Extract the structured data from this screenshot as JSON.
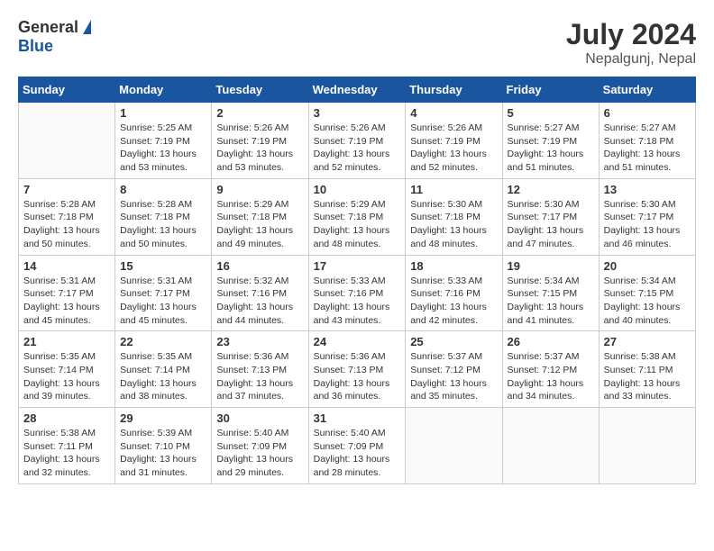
{
  "header": {
    "logo_general": "General",
    "logo_blue": "Blue",
    "month_year": "July 2024",
    "location": "Nepalgunj, Nepal"
  },
  "weekdays": [
    "Sunday",
    "Monday",
    "Tuesday",
    "Wednesday",
    "Thursday",
    "Friday",
    "Saturday"
  ],
  "weeks": [
    [
      {
        "day": "",
        "sunrise": "",
        "sunset": "",
        "daylight": ""
      },
      {
        "day": "1",
        "sunrise": "Sunrise: 5:25 AM",
        "sunset": "Sunset: 7:19 PM",
        "daylight": "Daylight: 13 hours and 53 minutes."
      },
      {
        "day": "2",
        "sunrise": "Sunrise: 5:26 AM",
        "sunset": "Sunset: 7:19 PM",
        "daylight": "Daylight: 13 hours and 53 minutes."
      },
      {
        "day": "3",
        "sunrise": "Sunrise: 5:26 AM",
        "sunset": "Sunset: 7:19 PM",
        "daylight": "Daylight: 13 hours and 52 minutes."
      },
      {
        "day": "4",
        "sunrise": "Sunrise: 5:26 AM",
        "sunset": "Sunset: 7:19 PM",
        "daylight": "Daylight: 13 hours and 52 minutes."
      },
      {
        "day": "5",
        "sunrise": "Sunrise: 5:27 AM",
        "sunset": "Sunset: 7:19 PM",
        "daylight": "Daylight: 13 hours and 51 minutes."
      },
      {
        "day": "6",
        "sunrise": "Sunrise: 5:27 AM",
        "sunset": "Sunset: 7:18 PM",
        "daylight": "Daylight: 13 hours and 51 minutes."
      }
    ],
    [
      {
        "day": "7",
        "sunrise": "Sunrise: 5:28 AM",
        "sunset": "Sunset: 7:18 PM",
        "daylight": "Daylight: 13 hours and 50 minutes."
      },
      {
        "day": "8",
        "sunrise": "Sunrise: 5:28 AM",
        "sunset": "Sunset: 7:18 PM",
        "daylight": "Daylight: 13 hours and 50 minutes."
      },
      {
        "day": "9",
        "sunrise": "Sunrise: 5:29 AM",
        "sunset": "Sunset: 7:18 PM",
        "daylight": "Daylight: 13 hours and 49 minutes."
      },
      {
        "day": "10",
        "sunrise": "Sunrise: 5:29 AM",
        "sunset": "Sunset: 7:18 PM",
        "daylight": "Daylight: 13 hours and 48 minutes."
      },
      {
        "day": "11",
        "sunrise": "Sunrise: 5:30 AM",
        "sunset": "Sunset: 7:18 PM",
        "daylight": "Daylight: 13 hours and 48 minutes."
      },
      {
        "day": "12",
        "sunrise": "Sunrise: 5:30 AM",
        "sunset": "Sunset: 7:17 PM",
        "daylight": "Daylight: 13 hours and 47 minutes."
      },
      {
        "day": "13",
        "sunrise": "Sunrise: 5:30 AM",
        "sunset": "Sunset: 7:17 PM",
        "daylight": "Daylight: 13 hours and 46 minutes."
      }
    ],
    [
      {
        "day": "14",
        "sunrise": "Sunrise: 5:31 AM",
        "sunset": "Sunset: 7:17 PM",
        "daylight": "Daylight: 13 hours and 45 minutes."
      },
      {
        "day": "15",
        "sunrise": "Sunrise: 5:31 AM",
        "sunset": "Sunset: 7:17 PM",
        "daylight": "Daylight: 13 hours and 45 minutes."
      },
      {
        "day": "16",
        "sunrise": "Sunrise: 5:32 AM",
        "sunset": "Sunset: 7:16 PM",
        "daylight": "Daylight: 13 hours and 44 minutes."
      },
      {
        "day": "17",
        "sunrise": "Sunrise: 5:33 AM",
        "sunset": "Sunset: 7:16 PM",
        "daylight": "Daylight: 13 hours and 43 minutes."
      },
      {
        "day": "18",
        "sunrise": "Sunrise: 5:33 AM",
        "sunset": "Sunset: 7:16 PM",
        "daylight": "Daylight: 13 hours and 42 minutes."
      },
      {
        "day": "19",
        "sunrise": "Sunrise: 5:34 AM",
        "sunset": "Sunset: 7:15 PM",
        "daylight": "Daylight: 13 hours and 41 minutes."
      },
      {
        "day": "20",
        "sunrise": "Sunrise: 5:34 AM",
        "sunset": "Sunset: 7:15 PM",
        "daylight": "Daylight: 13 hours and 40 minutes."
      }
    ],
    [
      {
        "day": "21",
        "sunrise": "Sunrise: 5:35 AM",
        "sunset": "Sunset: 7:14 PM",
        "daylight": "Daylight: 13 hours and 39 minutes."
      },
      {
        "day": "22",
        "sunrise": "Sunrise: 5:35 AM",
        "sunset": "Sunset: 7:14 PM",
        "daylight": "Daylight: 13 hours and 38 minutes."
      },
      {
        "day": "23",
        "sunrise": "Sunrise: 5:36 AM",
        "sunset": "Sunset: 7:13 PM",
        "daylight": "Daylight: 13 hours and 37 minutes."
      },
      {
        "day": "24",
        "sunrise": "Sunrise: 5:36 AM",
        "sunset": "Sunset: 7:13 PM",
        "daylight": "Daylight: 13 hours and 36 minutes."
      },
      {
        "day": "25",
        "sunrise": "Sunrise: 5:37 AM",
        "sunset": "Sunset: 7:12 PM",
        "daylight": "Daylight: 13 hours and 35 minutes."
      },
      {
        "day": "26",
        "sunrise": "Sunrise: 5:37 AM",
        "sunset": "Sunset: 7:12 PM",
        "daylight": "Daylight: 13 hours and 34 minutes."
      },
      {
        "day": "27",
        "sunrise": "Sunrise: 5:38 AM",
        "sunset": "Sunset: 7:11 PM",
        "daylight": "Daylight: 13 hours and 33 minutes."
      }
    ],
    [
      {
        "day": "28",
        "sunrise": "Sunrise: 5:38 AM",
        "sunset": "Sunset: 7:11 PM",
        "daylight": "Daylight: 13 hours and 32 minutes."
      },
      {
        "day": "29",
        "sunrise": "Sunrise: 5:39 AM",
        "sunset": "Sunset: 7:10 PM",
        "daylight": "Daylight: 13 hours and 31 minutes."
      },
      {
        "day": "30",
        "sunrise": "Sunrise: 5:40 AM",
        "sunset": "Sunset: 7:09 PM",
        "daylight": "Daylight: 13 hours and 29 minutes."
      },
      {
        "day": "31",
        "sunrise": "Sunrise: 5:40 AM",
        "sunset": "Sunset: 7:09 PM",
        "daylight": "Daylight: 13 hours and 28 minutes."
      },
      {
        "day": "",
        "sunrise": "",
        "sunset": "",
        "daylight": ""
      },
      {
        "day": "",
        "sunrise": "",
        "sunset": "",
        "daylight": ""
      },
      {
        "day": "",
        "sunrise": "",
        "sunset": "",
        "daylight": ""
      }
    ]
  ]
}
